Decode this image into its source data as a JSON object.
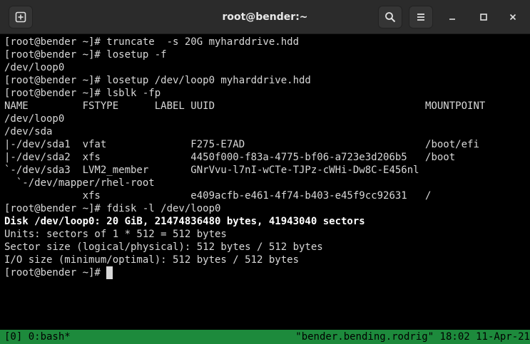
{
  "window": {
    "title": "root@bender:~"
  },
  "toolbar": {
    "new_tab_icon": "new-tab-icon",
    "search_icon": "search-icon",
    "menu_icon": "hamburger-menu-icon"
  },
  "terminal": {
    "lines": [
      "[root@bender ~]# truncate  -s 20G myharddrive.hdd",
      "[root@bender ~]# losetup -f",
      "/dev/loop0",
      "[root@bender ~]# losetup /dev/loop0 myharddrive.hdd",
      "[root@bender ~]# lsblk -fp",
      "NAME         FSTYPE      LABEL UUID                                   MOUNTPOINT",
      "/dev/loop0",
      "/dev/sda",
      "|-/dev/sda1  vfat              F275-E7AD                              /boot/efi",
      "|-/dev/sda2  xfs               4450f000-f83a-4775-bf06-a723e3d206b5   /boot",
      "`-/dev/sda3  LVM2_member       GNrVvu-l7nI-wCTe-TJPz-cWHi-Dw8C-E456nl",
      "  `-/dev/mapper/rhel-root",
      "             xfs               e409acfb-e461-4f74-b403-e45f9cc92631   /",
      "[root@bender ~]# fdisk -l /dev/loop0",
      "Disk /dev/loop0: 20 GiB, 21474836480 bytes, 41943040 sectors",
      "Units: sectors of 1 * 512 = 512 bytes",
      "Sector size (logical/physical): 512 bytes / 512 bytes",
      "I/O size (minimum/optimal): 512 bytes / 512 bytes",
      "[root@bender ~]# "
    ],
    "bold_line_index": 14
  },
  "statusbar": {
    "left": "[0] 0:bash*",
    "right": "\"bender.bending.rodrig\" 18:02 11-Apr-21"
  },
  "colors": {
    "statusbar_bg": "#1d8a3c",
    "terminal_bg": "#000000",
    "titlebar_bg": "#2b2b2b"
  }
}
